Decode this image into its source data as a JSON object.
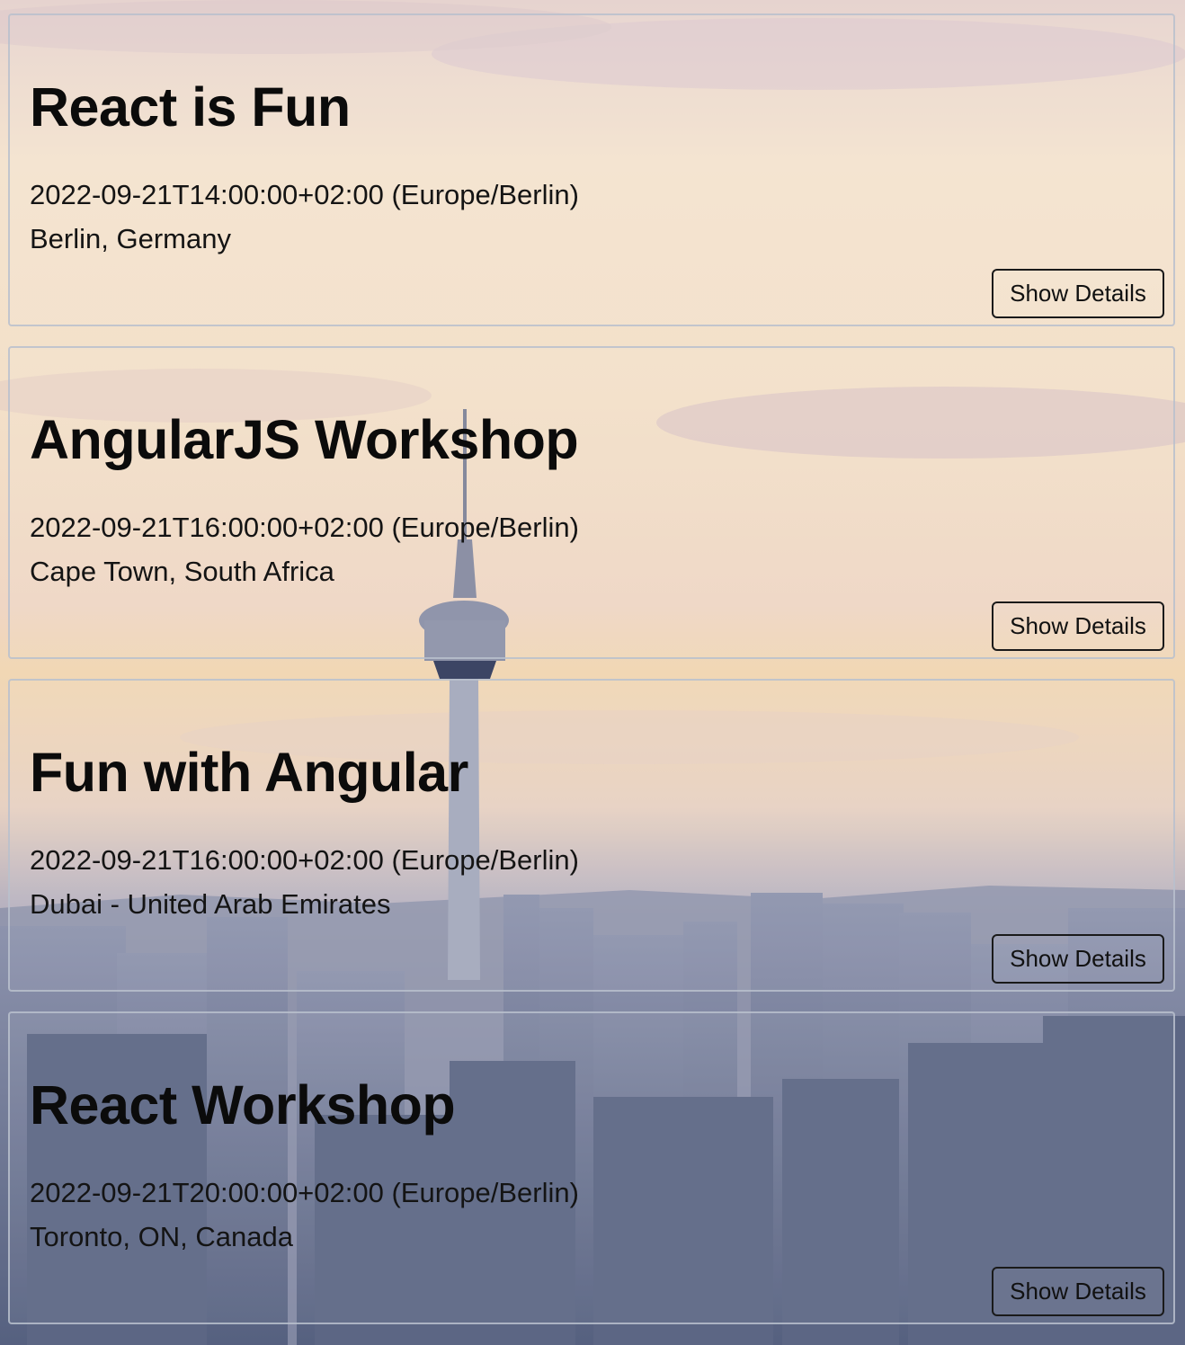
{
  "events": [
    {
      "title": "React is Fun",
      "datetime": "2022-09-21T14:00:00+02:00 (Europe/Berlin)",
      "location": "Berlin, Germany",
      "button_label": "Show Details"
    },
    {
      "title": "AngularJS Workshop",
      "datetime": "2022-09-21T16:00:00+02:00 (Europe/Berlin)",
      "location": "Cape Town, South Africa",
      "button_label": "Show Details"
    },
    {
      "title": "Fun with Angular",
      "datetime": "2022-09-21T16:00:00+02:00 (Europe/Berlin)",
      "location": "Dubai - United Arab Emirates",
      "button_label": "Show Details"
    },
    {
      "title": "React Workshop",
      "datetime": "2022-09-21T20:00:00+02:00 (Europe/Berlin)",
      "location": "Toronto, ON, Canada",
      "button_label": "Show Details"
    }
  ],
  "colors": {
    "sky_top": "#e9d8cf",
    "sky_warm": "#f6e4c8",
    "horizon": "#e8c9a6",
    "city": "#6f7895",
    "city_dark": "#4d5676"
  }
}
